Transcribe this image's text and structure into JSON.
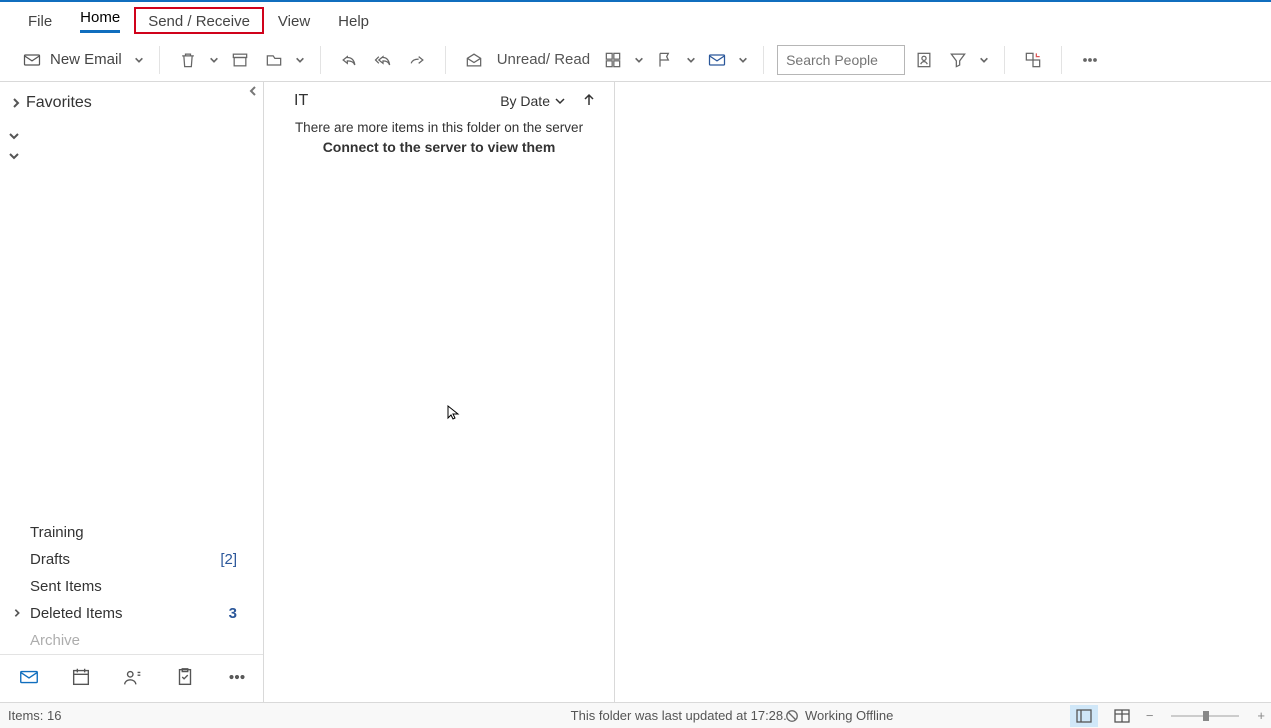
{
  "tabs": {
    "file": "File",
    "home": "Home",
    "send_receive": "Send / Receive",
    "view": "View",
    "help": "Help"
  },
  "ribbon": {
    "new_email": "New Email",
    "unread_read": "Unread/ Read",
    "search_placeholder": "Search People"
  },
  "nav": {
    "favorites": "Favorites",
    "training": "Training",
    "drafts": "Drafts",
    "drafts_count": "[2]",
    "sent": "Sent Items",
    "deleted": "Deleted Items",
    "deleted_count": "3",
    "archive": "Archive"
  },
  "msglist": {
    "title": "IT",
    "sort_by": "By Date",
    "info1": "There are more items in this folder on the server",
    "info2": "Connect to the server to view them"
  },
  "status": {
    "items": "Items: 16",
    "updated": "This folder was last updated at 17:28.",
    "offline": "Working Offline"
  }
}
